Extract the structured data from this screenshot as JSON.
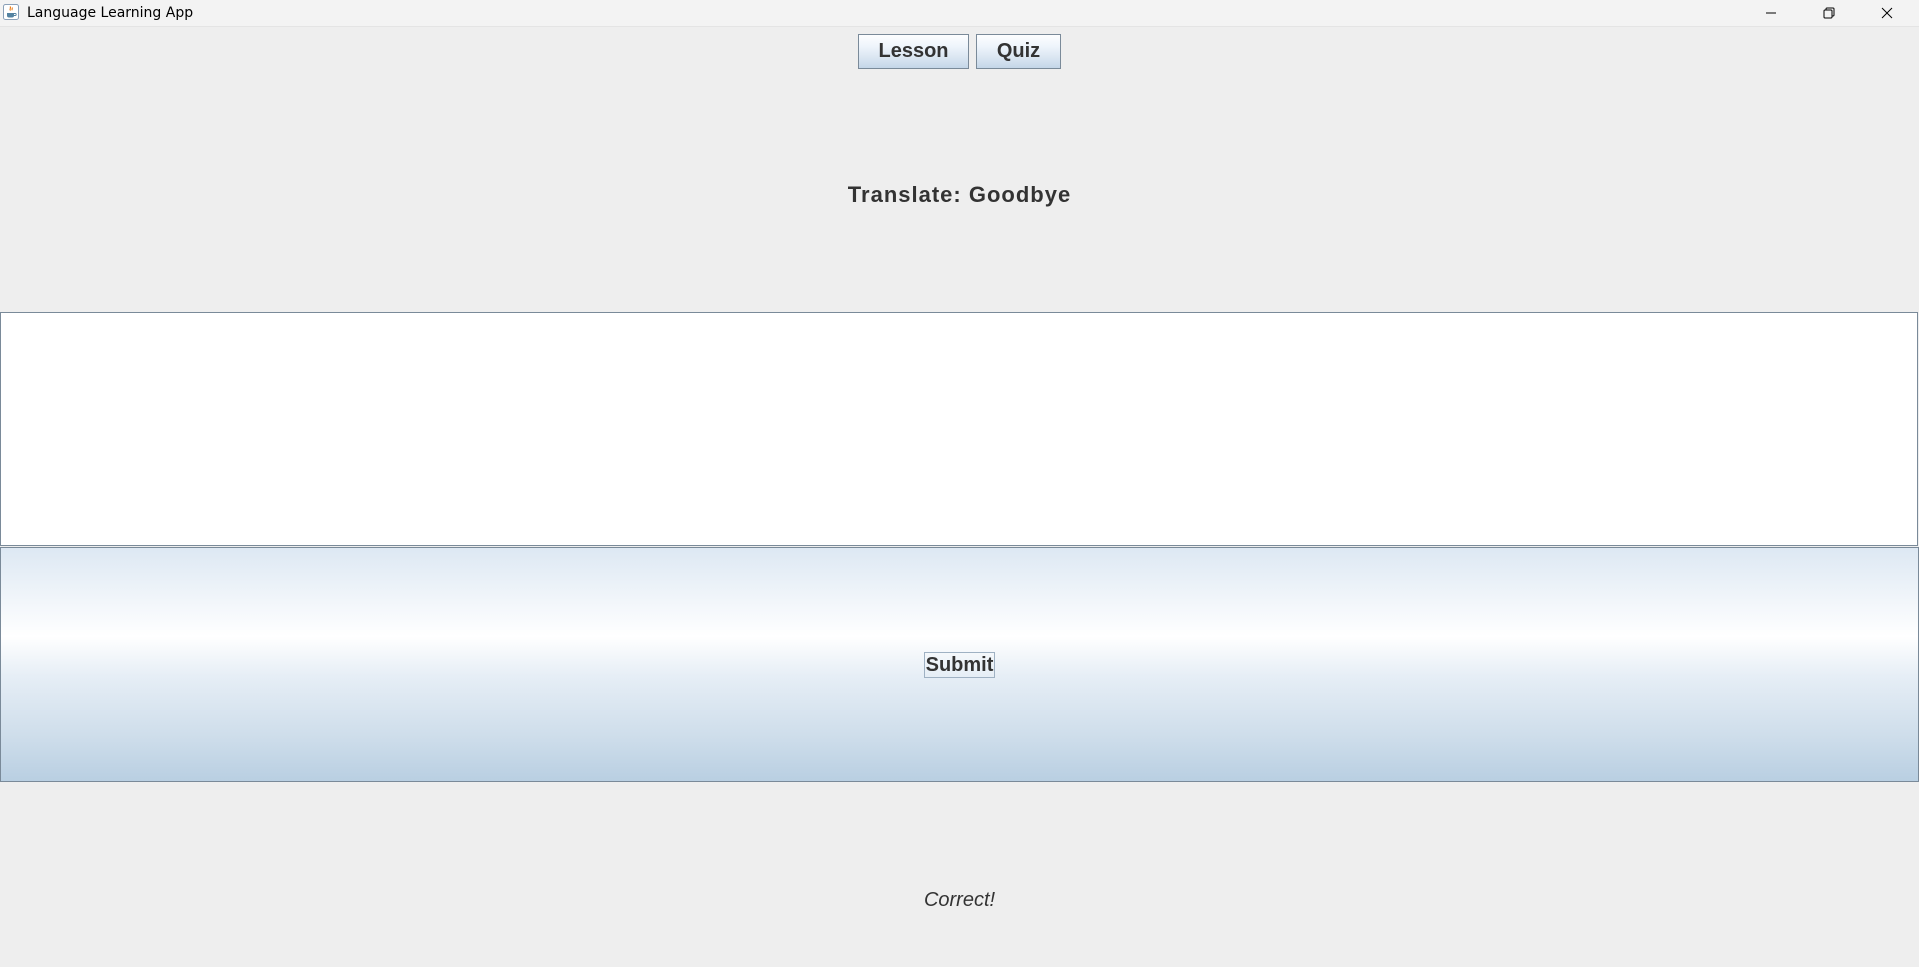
{
  "window": {
    "title": "Language Learning App",
    "icons": {
      "app": "java-cup-icon",
      "minimize": "minimize-icon",
      "maximize": "restore-icon",
      "close": "close-icon"
    }
  },
  "nav": {
    "lesson_label": "Lesson",
    "quiz_label": "Quiz"
  },
  "quiz": {
    "prompt": "Translate: Goodbye",
    "answer_value": "",
    "submit_label": "Submit",
    "feedback": "Correct!"
  },
  "colors": {
    "background": "#eeeeee",
    "text": "#333333",
    "border": "#7a8a99",
    "button_gradient_bottom": "#b9cfe2"
  }
}
